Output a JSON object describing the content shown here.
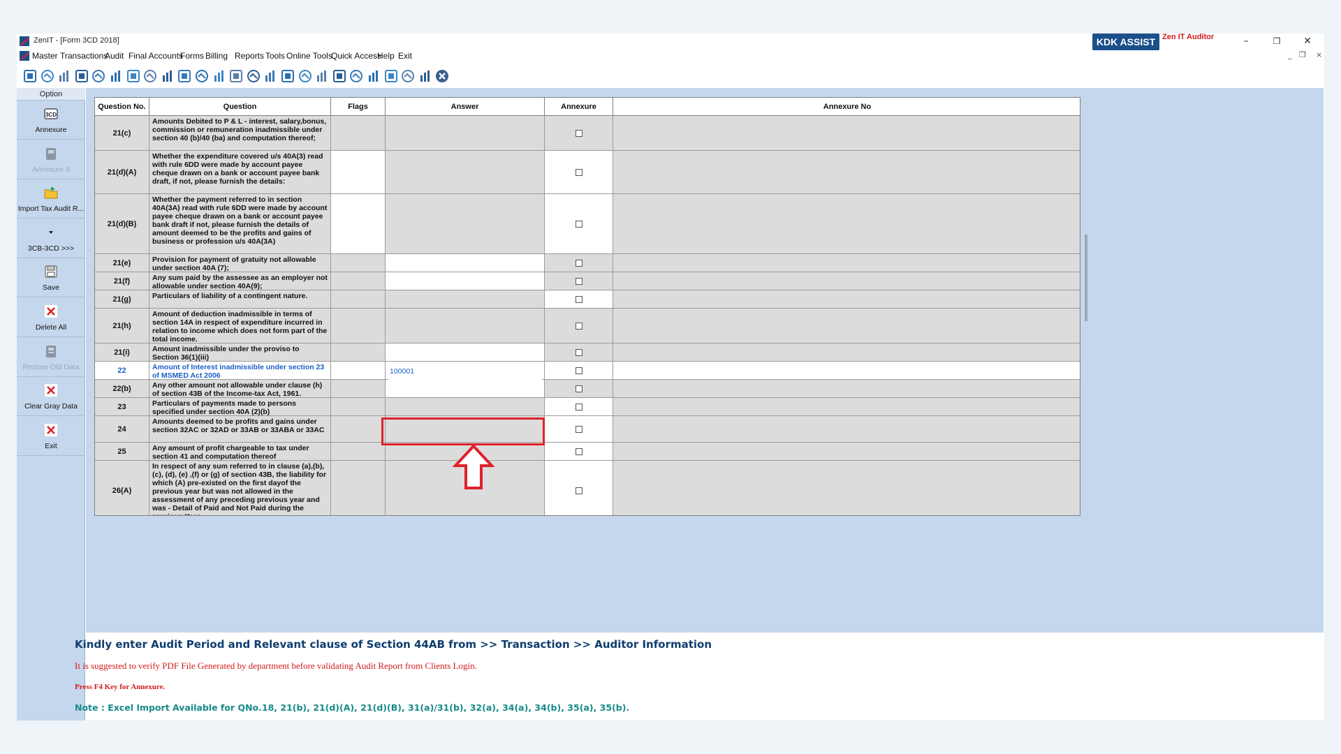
{
  "window": {
    "title": "ZenIT - [Form 3CD 2018]",
    "minimize": "–",
    "restore": "❐",
    "close": "✕"
  },
  "menu": {
    "items": [
      "Master",
      "Transactions",
      "Audit",
      "Final Accounts",
      "Forms",
      "Billing",
      "Reports",
      "Tools",
      "Online Tools",
      "Quick Access",
      "Help",
      "Exit"
    ],
    "mdi_min": "_",
    "mdi_restore": "❐",
    "mdi_close": "×"
  },
  "toolbar": {
    "kdk_assist": "KDK ASSIST",
    "zen_auditor": "Zen IT Auditor",
    "icons": [
      "back-icon",
      "home-icon",
      "building-icon",
      "chart-icon",
      "gift-icon",
      "users-icon",
      "tag-icon",
      "filter-icon",
      "tax-icon",
      "disc-icon",
      "calculator-icon",
      "pie-icon",
      "pay-icon",
      "book-icon",
      "info-icon",
      "report-icon",
      "doc-search-icon",
      "calendar-icon",
      "form-icon",
      "copy-icon",
      "tds-icon",
      "printer-icon",
      "3cd-icon",
      "export-icon",
      "close-circle-icon"
    ]
  },
  "left_panel": {
    "header": "Option",
    "buttons": [
      {
        "label": "Annexure",
        "icon": "annexure-3cd-icon",
        "enabled": true
      },
      {
        "label": "Annexure II",
        "icon": "annexure-ii-icon",
        "enabled": false
      },
      {
        "label": "Import Tax Audit R...",
        "icon": "import-folder-icon",
        "enabled": true
      },
      {
        "label": "3CB-3CD >>>",
        "icon": "dropdown-arrow-icon",
        "enabled": true
      },
      {
        "label": "Save",
        "icon": "save-disk-icon",
        "enabled": true
      },
      {
        "label": "Delete All",
        "icon": "delete-x-icon",
        "enabled": true
      },
      {
        "label": "Restore Old Data",
        "icon": "restore-icon",
        "enabled": false
      },
      {
        "label": "Clear Gray Data",
        "icon": "clear-x-icon",
        "enabled": true
      },
      {
        "label": "Exit",
        "icon": "exit-x-icon",
        "enabled": true
      }
    ]
  },
  "grid": {
    "headers": [
      "Question No.",
      "Question",
      "Flags",
      "Answer",
      "Annexure",
      "Annexure No"
    ],
    "rows": [
      {
        "no": "21(c)",
        "question": "Amounts Debited to P & L -  interest, salary,bonus, commission or remuneration inadmissible under section 40 (b)/40 (ba) and computation thereof;",
        "flags_white": false,
        "answer_white": false,
        "annex_white": false,
        "answer": ""
      },
      {
        "no": "21(d)(A)",
        "question": "Whether the expenditure covered u/s 40A(3) read with rule 6DD were made by account payee cheque drawn on a bank or account payee bank draft, if not, please furnish the details:",
        "flags_white": true,
        "answer_white": false,
        "annex_white": true,
        "answer": ""
      },
      {
        "no": "21(d)(B)",
        "question": "Whether the payment referred to in section 40A(3A) read with rule 6DD were made by account payee cheque drawn on a bank or account payee bank draft if not, please furnish the details of amount deemed to be the profits and gains of business or profession u/s 40A(3A)",
        "flags_white": true,
        "answer_white": false,
        "annex_white": true,
        "answer": ""
      },
      {
        "no": "21(e)",
        "question": "Provision for payment of gratuity not allowable  under section 40A (7);",
        "flags_white": false,
        "answer_white": true,
        "annex_white": false,
        "answer": ""
      },
      {
        "no": "21(f)",
        "question": "Any sum paid by the assessee as an employer not allowable under section 40A(9);",
        "flags_white": false,
        "answer_white": true,
        "annex_white": false,
        "answer": ""
      },
      {
        "no": "21(g)",
        "question": "Particulars of liability of a contingent nature.",
        "flags_white": false,
        "answer_white": false,
        "annex_white": true,
        "answer": ""
      },
      {
        "no": "21(h)",
        "question": "Amount of deduction inadmissible in terms of section 14A in respect of expenditure incurred in relation to income which does not form part of the total income.",
        "flags_white": false,
        "answer_white": false,
        "annex_white": false,
        "answer": ""
      },
      {
        "no": "21(i)",
        "question": "Amount inadmissible under the proviso to Section 36(1)(iii)",
        "flags_white": false,
        "answer_white": true,
        "annex_white": false,
        "answer": ""
      },
      {
        "no": "22",
        "question": "Amount of Interest inadmissible under section 23 of MSMED Act 2006",
        "flags_white": true,
        "answer_white": true,
        "annex_white": true,
        "answer": "100001",
        "selected": true
      },
      {
        "no": "22(b)",
        "question": "Any other amount not allowable under clause (h) of section 43B of the Income-tax Act, 1961.",
        "flags_white": false,
        "answer_white": true,
        "annex_white": false,
        "answer": ""
      },
      {
        "no": "23",
        "question": "Particulars of payments made to persons specified under section 40A (2)(b)",
        "flags_white": false,
        "answer_white": false,
        "annex_white": true,
        "answer": ""
      },
      {
        "no": "24",
        "question": "Amounts deemed to be profits and gains under section 32AC or 32AD or 33AB or 33ABA or 33AC",
        "flags_white": false,
        "answer_white": false,
        "annex_white": true,
        "answer": ""
      },
      {
        "no": "25",
        "question": "Any amount of profit chargeable to tax under section 41 and computation thereof",
        "flags_white": false,
        "answer_white": false,
        "annex_white": true,
        "answer": ""
      },
      {
        "no": "26(A)",
        "question": "In respect of any sum referred to in clause (a),(b),(c), (d), (e) ,(f) or (g) of section 43B, the liability for which (A) pre-existed on the first dayof the previous year but was not allowed in the assessment of any preceding previous year and was - Detail of Paid and Not Paid during the previous Year",
        "flags_white": false,
        "answer_white": false,
        "annex_white": true,
        "answer": ""
      },
      {
        "no": "",
        "question": "",
        "flags_white": false,
        "answer_white": false,
        "annex_white": true,
        "answer": ""
      }
    ]
  },
  "notes": {
    "main": "Kindly enter Audit Period and Relevant clause of Section 44AB from >> Transaction >> Auditor Information",
    "pdf": "It is suggested to verify PDF File Generated by department before validating Audit Report from Clients Login.",
    "f4": "Press F4 Key for Annexure.",
    "excel": "Note : Excel Import Available for QNo.18, 21(b), 21(d)(A), 21(d)(B), 31(a)/31(b), 32(a), 34(a), 34(b), 35(a), 35(b)."
  },
  "colors": {
    "accent": "#1b4f8a",
    "panel": "#c5d7ec",
    "highlight": "#e0202a",
    "note_red": "#d21c1c",
    "note_teal": "#178a8a"
  }
}
